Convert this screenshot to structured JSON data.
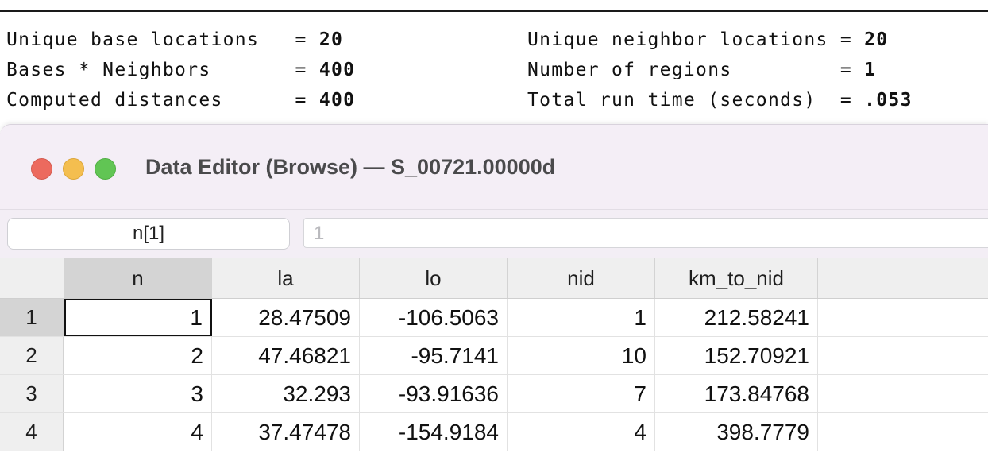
{
  "results": {
    "lines": [
      {
        "l_label": "Unique base locations   = ",
        "l_value": "20",
        "r_label": "Unique neighbor locations = ",
        "r_value": "20"
      },
      {
        "l_label": "Bases * Neighbors       = ",
        "l_value": "400",
        "r_label": "Number of regions         = ",
        "r_value": "1"
      },
      {
        "l_label": "Computed distances      = ",
        "l_value": "400",
        "r_label": "Total run time (seconds)  = ",
        "r_value": ".053"
      }
    ]
  },
  "window": {
    "title": "Data Editor (Browse) — S_00721.00000d",
    "controls": {
      "close": "close",
      "minimize": "minimize",
      "zoom": "zoom"
    }
  },
  "toolbar": {
    "varname": "n[1]",
    "value": "1"
  },
  "grid": {
    "columns": [
      "n",
      "la",
      "lo",
      "nid",
      "km_to_nid",
      "",
      ""
    ],
    "rows": [
      {
        "num": "1",
        "cells": [
          "1",
          "28.47509",
          "-106.5063",
          "1",
          "212.58241"
        ]
      },
      {
        "num": "2",
        "cells": [
          "2",
          "47.46821",
          "-95.7141",
          "10",
          "152.70921"
        ]
      },
      {
        "num": "3",
        "cells": [
          "3",
          "32.293",
          "-93.91636",
          "7",
          "173.84768"
        ]
      },
      {
        "num": "4",
        "cells": [
          "4",
          "37.47478",
          "-154.9184",
          "4",
          "398.7779"
        ]
      }
    ]
  },
  "colors": {
    "close": "#ec6a5e",
    "minimize": "#f4be4f",
    "zoom": "#61c554",
    "selection": "#d4d4d4"
  }
}
